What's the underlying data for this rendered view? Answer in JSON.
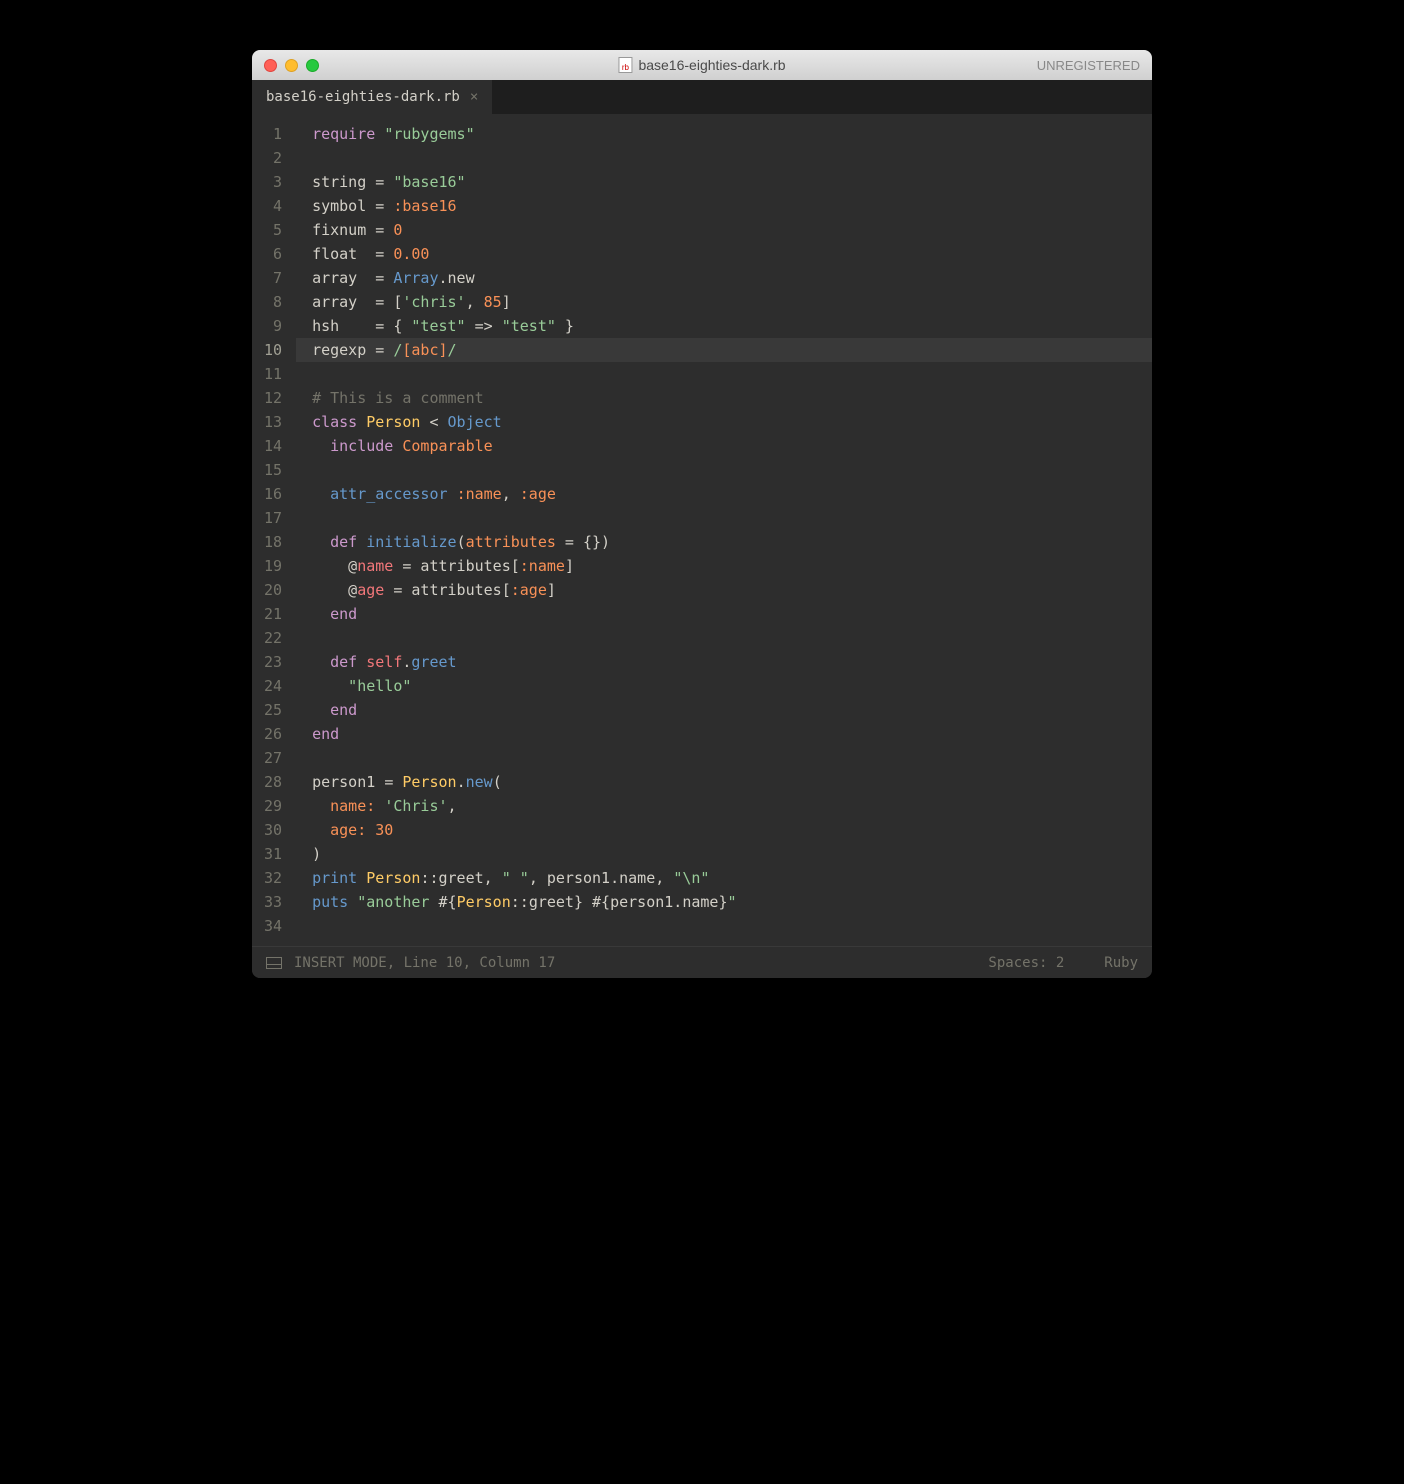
{
  "window": {
    "title": "base16-eighties-dark.rb",
    "unregistered": "UNREGISTERED"
  },
  "tab": {
    "name": "base16-eighties-dark.rb",
    "close": "×"
  },
  "colors": {
    "keyword": "#cc99cc",
    "string": "#99cc99",
    "number": "#f99157",
    "classname": "#ffcc66",
    "func": "#6699cc",
    "var": "#f2777a",
    "comment": "#747369",
    "plain": "#d3d0c8",
    "const": "#f99157"
  },
  "active_line": 10,
  "lines": [
    [
      [
        "require ",
        "keyword"
      ],
      [
        "\"rubygems\"",
        "string"
      ]
    ],
    [
      [
        "",
        "plain"
      ]
    ],
    [
      [
        "string ",
        "plain"
      ],
      [
        "= ",
        "plain"
      ],
      [
        "\"base16\"",
        "string"
      ]
    ],
    [
      [
        "symbol ",
        "plain"
      ],
      [
        "= ",
        "plain"
      ],
      [
        ":base16",
        "const"
      ]
    ],
    [
      [
        "fixnum ",
        "plain"
      ],
      [
        "= ",
        "plain"
      ],
      [
        "0",
        "number"
      ]
    ],
    [
      [
        "float  ",
        "plain"
      ],
      [
        "= ",
        "plain"
      ],
      [
        "0.00",
        "number"
      ]
    ],
    [
      [
        "array  ",
        "plain"
      ],
      [
        "= ",
        "plain"
      ],
      [
        "Array",
        "func"
      ],
      [
        ".",
        "plain"
      ],
      [
        "new",
        "plain"
      ]
    ],
    [
      [
        "array  ",
        "plain"
      ],
      [
        "= [",
        "plain"
      ],
      [
        "'chris'",
        "string"
      ],
      [
        ", ",
        "plain"
      ],
      [
        "85",
        "number"
      ],
      [
        "]",
        "plain"
      ]
    ],
    [
      [
        "hsh    ",
        "plain"
      ],
      [
        "= { ",
        "plain"
      ],
      [
        "\"test\"",
        "string"
      ],
      [
        " => ",
        "plain"
      ],
      [
        "\"test\"",
        "string"
      ],
      [
        " }",
        "plain"
      ]
    ],
    [
      [
        "regexp ",
        "plain"
      ],
      [
        "= ",
        "plain"
      ],
      [
        "/",
        "string"
      ],
      [
        "[abc]",
        "number"
      ],
      [
        "/",
        "string"
      ]
    ],
    [
      [
        "",
        "plain"
      ]
    ],
    [
      [
        "# This is a comment",
        "comment"
      ]
    ],
    [
      [
        "class ",
        "keyword"
      ],
      [
        "Person",
        "classname"
      ],
      [
        " < ",
        "plain"
      ],
      [
        "Object",
        "func"
      ]
    ],
    [
      [
        "  include ",
        "keyword"
      ],
      [
        "Comparable",
        "const"
      ]
    ],
    [
      [
        "",
        "plain"
      ]
    ],
    [
      [
        "  attr_accessor ",
        "func"
      ],
      [
        ":name",
        "const"
      ],
      [
        ", ",
        "plain"
      ],
      [
        ":age",
        "const"
      ]
    ],
    [
      [
        "",
        "plain"
      ]
    ],
    [
      [
        "  def ",
        "keyword"
      ],
      [
        "initialize",
        "func"
      ],
      [
        "(",
        "plain"
      ],
      [
        "attributes",
        "const"
      ],
      [
        " = {})",
        "plain"
      ]
    ],
    [
      [
        "    @",
        "plain"
      ],
      [
        "name",
        "var"
      ],
      [
        " = attributes[",
        "plain"
      ],
      [
        ":name",
        "const"
      ],
      [
        "]",
        "plain"
      ]
    ],
    [
      [
        "    @",
        "plain"
      ],
      [
        "age",
        "var"
      ],
      [
        " = attributes[",
        "plain"
      ],
      [
        ":age",
        "const"
      ],
      [
        "]",
        "plain"
      ]
    ],
    [
      [
        "  end",
        "keyword"
      ]
    ],
    [
      [
        "",
        "plain"
      ]
    ],
    [
      [
        "  def ",
        "keyword"
      ],
      [
        "self",
        "var"
      ],
      [
        ".",
        "plain"
      ],
      [
        "greet",
        "func"
      ]
    ],
    [
      [
        "    \"hello\"",
        "string"
      ]
    ],
    [
      [
        "  end",
        "keyword"
      ]
    ],
    [
      [
        "end",
        "keyword"
      ]
    ],
    [
      [
        "",
        "plain"
      ]
    ],
    [
      [
        "person1 ",
        "plain"
      ],
      [
        "= ",
        "plain"
      ],
      [
        "Person",
        "classname"
      ],
      [
        ".",
        "plain"
      ],
      [
        "new",
        "func"
      ],
      [
        "(",
        "plain"
      ]
    ],
    [
      [
        "  name: ",
        "const"
      ],
      [
        "'Chris'",
        "string"
      ],
      [
        ",",
        "plain"
      ]
    ],
    [
      [
        "  age: ",
        "const"
      ],
      [
        "30",
        "number"
      ]
    ],
    [
      [
        ")",
        "plain"
      ]
    ],
    [
      [
        "print ",
        "func"
      ],
      [
        "Person",
        "classname"
      ],
      [
        "::",
        "plain"
      ],
      [
        "greet",
        "plain"
      ],
      [
        ", ",
        "plain"
      ],
      [
        "\" \"",
        "string"
      ],
      [
        ", person1.name, ",
        "plain"
      ],
      [
        "\"\\n\"",
        "string"
      ]
    ],
    [
      [
        "puts ",
        "func"
      ],
      [
        "\"another ",
        "string"
      ],
      [
        "#{",
        "plain"
      ],
      [
        "Person",
        "classname"
      ],
      [
        "::",
        "plain"
      ],
      [
        "greet",
        "plain"
      ],
      [
        "}",
        "plain"
      ],
      [
        " ",
        "string"
      ],
      [
        "#{",
        "plain"
      ],
      [
        "person1.name",
        "plain"
      ],
      [
        "}",
        "plain"
      ],
      [
        "\"",
        "string"
      ]
    ],
    [
      [
        "",
        "plain"
      ]
    ]
  ],
  "status": {
    "left": "INSERT MODE, Line 10, Column 17",
    "spaces": "Spaces: 2",
    "lang": "Ruby"
  }
}
